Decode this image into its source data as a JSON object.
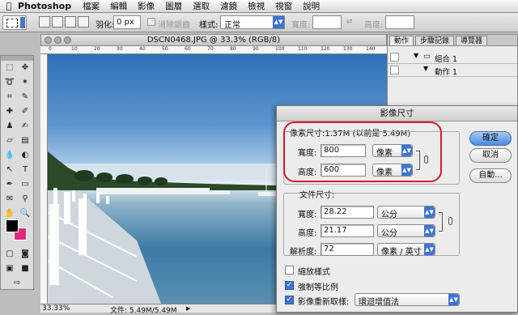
{
  "menubar": {
    "apple": "",
    "app_name": "Photoshop",
    "items": [
      "檔案",
      "編輯",
      "影像",
      "圖層",
      "選取",
      "濾鏡",
      "檢視",
      "視窗",
      "說明"
    ]
  },
  "options_bar": {
    "feather_label": "羽化:",
    "feather_value": "0 px",
    "antialias_label": "消除鋸齒",
    "style_label": "樣式:",
    "style_value": "正常",
    "width_label": "寬度:",
    "height_label": "高度:"
  },
  "document": {
    "title": "DSCN0468.JPG @ 33.3% (RGB/8)",
    "ruler_ticks": [
      "0",
      "10",
      "20",
      "30",
      "40",
      "50",
      "60",
      "70",
      "80",
      "90",
      "100",
      "110",
      "120",
      "130",
      "140"
    ],
    "zoom": "33.33%",
    "doc_info": "文件: 5.49M/5.49M"
  },
  "layers_panel": {
    "tabs": [
      "動作",
      "步驟記錄",
      "導覽器"
    ],
    "rows": [
      "組合 1",
      "動作 1"
    ]
  },
  "dialog": {
    "title": "影像尺寸",
    "pixel_dimensions": "像素尺寸:1.37M (以前是 5.49M)",
    "width_label": "寬度:",
    "width_value": "800",
    "width_unit": "像素",
    "height_label": "高度:",
    "height_value": "600",
    "height_unit": "像素",
    "document_size": "文件尺寸:",
    "doc_width_label": "寬度:",
    "doc_width_value": "28.22",
    "doc_width_unit": "公分",
    "doc_height_label": "高度:",
    "doc_height_value": "21.17",
    "doc_height_unit": "公分",
    "resolution_label": "解析度:",
    "resolution_value": "72",
    "resolution_unit": "像素 / 英寸",
    "scale_styles": "縮放樣式",
    "constrain": "強制等比例",
    "resample": "影像重新取樣:",
    "resample_method": "環迴增值法",
    "ok": "確定",
    "cancel": "取消",
    "auto": "自動..."
  },
  "colors": {
    "foreground": "#000000",
    "background": "#e0287a",
    "highlight": "#d21e2e"
  }
}
